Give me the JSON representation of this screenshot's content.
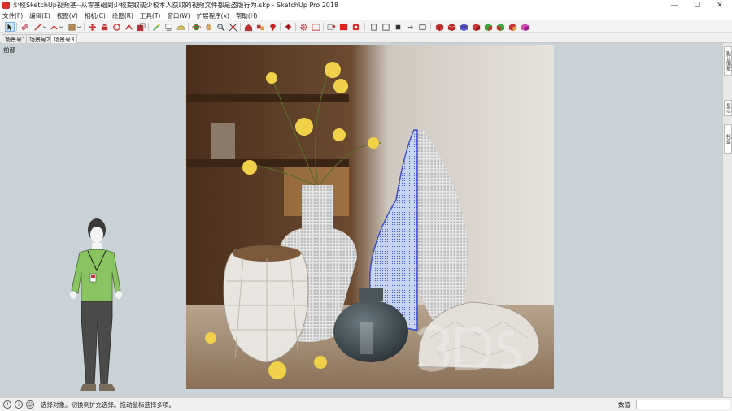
{
  "window": {
    "title": "少校SketchUp视频基--从零基础到少校提取或少校本人获取的视频文件都是盗版行为.skp - SketchUp Pro 2018",
    "minimize": "—",
    "maximize": "☐",
    "close": "✕"
  },
  "menu": {
    "items": [
      "文件(F)",
      "编辑(E)",
      "视图(V)",
      "相机(C)",
      "绘图(R)",
      "工具(T)",
      "窗口(W)",
      "扩展程序(x)",
      "帮助(H)"
    ]
  },
  "toolbar": {
    "tools": [
      "select-icon",
      "eraser-icon",
      "line-icon",
      "dropdown-icon",
      "arc-icon",
      "dropdown-icon",
      "shape-icon",
      "dropdown-icon",
      "move-icon",
      "push-pull-icon",
      "rotate-icon",
      "follow-me-icon",
      "scale-icon",
      "offset-icon",
      "tape-measure-icon",
      "text-icon",
      "protractor-icon",
      "orbit-icon",
      "pan-icon",
      "zoom-icon",
      "zoom-extents-icon",
      "warehouse-icon",
      "components-icon",
      "ruby-icon",
      "settings-icon",
      "outliner-icon",
      "section-icon",
      "paint-icon",
      "red-cube-icon",
      "standard-view-iso-icon",
      "top-view-icon",
      "front-view-icon",
      "right-view-icon",
      "back-view-icon",
      "left-view-icon",
      "style-xray-icon",
      "style-wireframe-icon",
      "style-hidden-icon",
      "style-shaded-icon",
      "style-textured-icon",
      "style-mono-icon"
    ]
  },
  "scenes": {
    "tabs": [
      "场景号1",
      "场景号2",
      "场景号3"
    ],
    "active_index": 2
  },
  "viewport": {
    "camera_label": "前部",
    "background_color": "#c8d2d7",
    "selection_color": "#3a4ad0"
  },
  "right_panel": {
    "tabs": [
      "默认面板",
      "显示",
      "托盘"
    ]
  },
  "status": {
    "message": "选择对象。切换到扩充选择。拖动鼠标选择多项。",
    "measurements_label": "数值",
    "measurements_value": ""
  }
}
